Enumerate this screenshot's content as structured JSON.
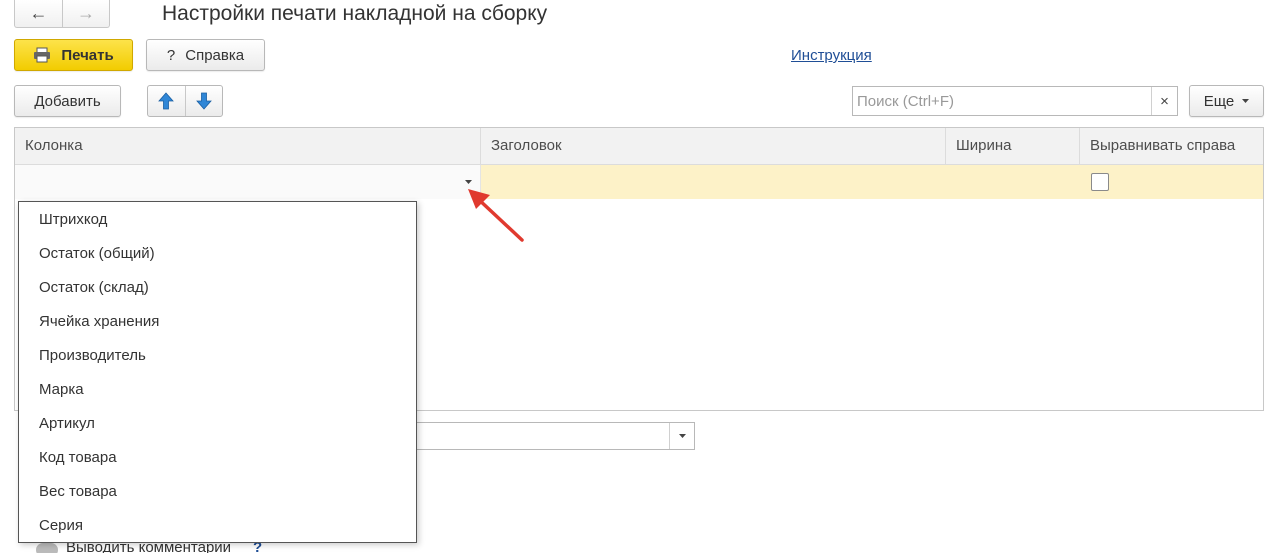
{
  "window": {
    "title": "Настройки печати накладной на сборку"
  },
  "nav": {
    "back": "←",
    "forward": "→"
  },
  "toolbar": {
    "print_label": "Печать",
    "help_label": "Справка",
    "help_glyph": "?",
    "instruction_link": "Инструкция"
  },
  "list_toolbar": {
    "add_label": "Добавить",
    "search_placeholder": "Поиск (Ctrl+F)",
    "clear_glyph": "×",
    "more_label": "Еще"
  },
  "table": {
    "columns": [
      "Колонка",
      "Заголовок",
      "Ширина",
      "Выравнивать справа"
    ],
    "row": {
      "column_value": "",
      "title_value": "",
      "width_value": "",
      "align_right": false
    }
  },
  "dropdown": {
    "items": [
      "Штрихкод",
      "Остаток (общий)",
      "Остаток (склад)",
      "Ячейка хранения",
      "Производитель",
      "Марка",
      "Артикул",
      "Код товара",
      "Вес товара",
      "Серия"
    ]
  },
  "background": {
    "comment_label": "Выводить комментарии",
    "help_mark": "?"
  },
  "colors": {
    "print_button": "#f2cc00",
    "selected_row": "#fdf2c8",
    "link": "#1f4e96",
    "arrow_up_down": "#2f86d6",
    "annotation_arrow": "#e03a2f"
  }
}
